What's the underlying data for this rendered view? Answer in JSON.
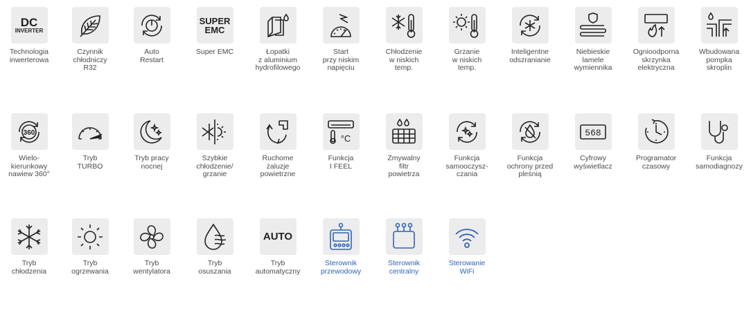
{
  "row1": [
    {
      "icon": "dc-inverter-icon",
      "icon_text": "DC",
      "icon_subtext": "INVERTER",
      "label": "Technologia\ninwerterowa"
    },
    {
      "icon": "leaf-icon",
      "label": "Czynnik\nchłodniczy\nR32"
    },
    {
      "icon": "power-restart-icon",
      "label": "Auto\nRestart"
    },
    {
      "icon": "super-emc-icon",
      "icon_text": "SUPER",
      "icon_subtext": "EMC",
      "label": "Super EMC"
    },
    {
      "icon": "fin-droplet-icon",
      "label": "Łopatki\nz aluminium\nhydrofilowego"
    },
    {
      "icon": "low-voltage-gauge-icon",
      "label": "Start\nprzy niskim\nnapięciu"
    },
    {
      "icon": "snowflake-thermometer-icon",
      "label": "Chłodzenie\nw niskich\ntemp."
    },
    {
      "icon": "sun-thermometer-icon",
      "label": "Grzanie\nw niskich\ntemp."
    },
    {
      "icon": "smart-defrost-icon",
      "label": "Inteligentne\nodszranianie"
    },
    {
      "icon": "blue-fins-shield-icon",
      "label": "Niebieskie\nlamele\nwymiennika"
    },
    {
      "icon": "fireproof-box-icon",
      "label": "Ognioodporna\nskrzynka\nelektryczna"
    },
    {
      "icon": "condensate-pump-icon",
      "label": "Wbudowana\npompka\nskroplin"
    }
  ],
  "row2": [
    {
      "icon": "airflow-360-icon",
      "icon_text": "360",
      "label": "Wielo-\nkierunkowy\nnawiew 360°"
    },
    {
      "icon": "turbo-gauge-icon",
      "label": "Tryb\nTURBO"
    },
    {
      "icon": "moon-stars-icon",
      "label": "Tryb pracy\nnocnej"
    },
    {
      "icon": "snow-sun-icon",
      "label": "Szybkie\nchłodzenie/\ngrzanie"
    },
    {
      "icon": "swing-louver-icon",
      "label": "Ruchome\nżaluzje\npowietrzne"
    },
    {
      "icon": "ifeel-remote-icon",
      "icon_text": "°C",
      "label": "Funkcja\nI FEEL"
    },
    {
      "icon": "washable-filter-icon",
      "label": "Zmywalny\nfiltr\npowietrza"
    },
    {
      "icon": "self-clean-icon",
      "label": "Funkcja\nsamooczysz-\nczania"
    },
    {
      "icon": "anti-mold-icon",
      "label": "Funkcja\nochrony przed\npleśnią"
    },
    {
      "icon": "digital-display-icon",
      "icon_text": "568",
      "label": "Cyfrowy\nwyświetlacz"
    },
    {
      "icon": "timer-clock-icon",
      "label": "Programator\nczasowy"
    },
    {
      "icon": "stethoscope-icon",
      "label": "Funkcja\nsamodiagnozy"
    }
  ],
  "row3": [
    {
      "icon": "cooling-snowflake-icon",
      "label": "Tryb\nchłodzenia",
      "blue": false
    },
    {
      "icon": "heating-sun-icon",
      "label": "Tryb\nogrzewania",
      "blue": false
    },
    {
      "icon": "fan-icon",
      "label": "Tryb\nwentylatora",
      "blue": false
    },
    {
      "icon": "dry-droplet-icon",
      "label": "Tryb\nosuszania",
      "blue": false
    },
    {
      "icon": "auto-mode-icon",
      "icon_text": "AUTO",
      "label": "Tryb\nautomatyczny",
      "blue": false
    },
    {
      "icon": "wired-controller-icon",
      "label": "Sterownik\nprzewodowy",
      "blue": true
    },
    {
      "icon": "central-controller-icon",
      "label": "Sterownik\ncentralny",
      "blue": true
    },
    {
      "icon": "wifi-icon",
      "label": "Sterowanie\nWiFi",
      "blue": true
    }
  ],
  "colors": {
    "tile": "#ececec",
    "icon": "#222222",
    "label": "#4a4a4a",
    "accent_blue": "#2f63b8"
  }
}
